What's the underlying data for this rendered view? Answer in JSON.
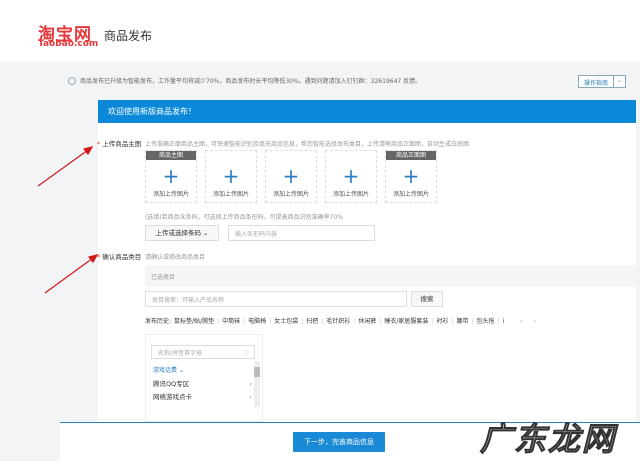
{
  "header": {
    "logo_cn": "淘宝网",
    "logo_en": "Taobao.com",
    "title": "商品发布"
  },
  "notice": {
    "text": "商品发布已升级为智能发布，工作量平均将减少70%，商品发布时长平均降低30%。遇到问题请加入钉钉群：32619647 反馈。",
    "guide": "操作指南"
  },
  "banner": "欢迎使用新版商品发布！",
  "upload": {
    "label": "上传商品主图",
    "hint": "上传准确正面商品主图，可快速智能识别及填充商品信息，帮您智能选择发布类目，上传清晰商品正面图，自动生成白底图",
    "slots": [
      {
        "tag": "商品主图",
        "text": "添加上传图片"
      },
      {
        "tag": "",
        "text": "添加上传图片"
      },
      {
        "tag": "",
        "text": "添加上传图片"
      },
      {
        "tag": "",
        "text": "添加上传图片"
      },
      {
        "tag": "商品正面图",
        "text": "添加上传图片"
      }
    ],
    "barcode_hint": "(选填)若商品含条码，可选择上传商品条形码，可提高商品识别准确率70%",
    "barcode_button": "上传或选择条码",
    "barcode_placeholder": "输入条形码内容"
  },
  "category": {
    "label": "确认商品类目",
    "hint": "请确认或修改商品类目",
    "selected": "已选类目",
    "search_placeholder": "类目搜索：可输入产品名称",
    "search_button": "搜索",
    "history_label": "发布历史:",
    "history": [
      "鼠标垫/贴/腕垫",
      "中筒袜",
      "电脑椅",
      "女士包袋",
      "扫把",
      "毛针织衫",
      "休闲裤",
      "睡衣/家居服套装",
      "衬衫",
      "腰带",
      "包头拖",
      "i"
    ],
    "tree_placeholder": "名称/拼音首字母",
    "tree_group": "游戏话费",
    "tree_items": [
      "腾讯QQ专区",
      "网络游戏点卡"
    ]
  },
  "footer": {
    "next_button": "下一步，完善商品信息"
  },
  "watermark": "广东龙网",
  "colors": {
    "brand": "#e4393c",
    "accent": "#0b89d8"
  }
}
